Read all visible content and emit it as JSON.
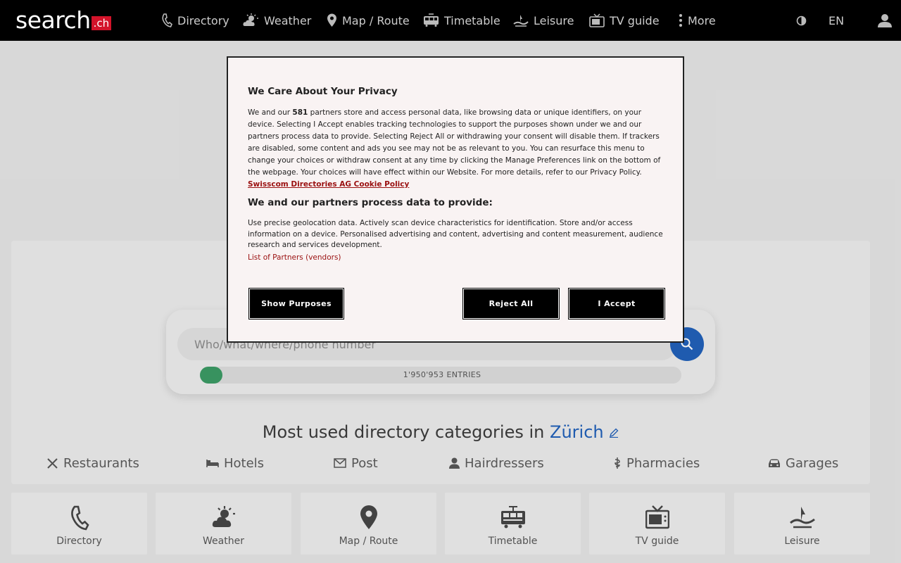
{
  "logo": {
    "text": "search",
    "badge": ".ch"
  },
  "nav": {
    "items": [
      {
        "label": "Directory",
        "icon": "phone-icon"
      },
      {
        "label": "Weather",
        "icon": "weather-icon"
      },
      {
        "label": "Map / Route",
        "icon": "map-pin-icon"
      },
      {
        "label": "Timetable",
        "icon": "train-icon"
      },
      {
        "label": "Leisure",
        "icon": "leisure-icon"
      },
      {
        "label": "TV guide",
        "icon": "tv-icon"
      },
      {
        "label": "More",
        "icon": "more-icon"
      }
    ],
    "language": "EN"
  },
  "search": {
    "placeholder": "Who/what/where/phone number",
    "entries_count": "1'950'953",
    "entries_label": "ENTRIES"
  },
  "categories": {
    "title_prefix": "Most used directory categories in",
    "city": "Zürich",
    "items": [
      {
        "label": "Restaurants",
        "icon": "restaurant-icon"
      },
      {
        "label": "Hotels",
        "icon": "bed-icon"
      },
      {
        "label": "Post",
        "icon": "mail-icon"
      },
      {
        "label": "Hairdressers",
        "icon": "person-icon"
      },
      {
        "label": "Pharmacies",
        "icon": "pharmacy-icon"
      },
      {
        "label": "Garages",
        "icon": "car-icon"
      }
    ]
  },
  "tiles": [
    {
      "label": "Directory"
    },
    {
      "label": "Weather"
    },
    {
      "label": "Map / Route"
    },
    {
      "label": "Timetable"
    },
    {
      "label": "TV guide"
    },
    {
      "label": "Leisure"
    }
  ],
  "consent": {
    "title": "We Care About Your Privacy",
    "body_1": "We and our",
    "partner_count": "581",
    "body_2": "partners store and access personal data, like browsing data or unique identifiers, on your device. Selecting I Accept enables tracking technologies to support the purposes shown under we and our partners process data to provide. Selecting Reject All or withdrawing your consent will disable them. If trackers are disabled, some content and ads you see may not be as relevant to you. You can resurface this menu to change your choices or withdraw consent at any time by clicking the Manage Preferences link on the bottom of the webpage. Your choices will have effect within our Website. For more details, refer to our Privacy Policy.",
    "policy_link": "Swisscom Directories AG Cookie Policy",
    "subtitle": "We and our partners process data to provide:",
    "purposes": "Use precise geolocation data. Actively scan device characteristics for identification. Store and/or access information on a device. Personalised advertising and content, advertising and content measurement, audience research and services development.",
    "partners_link": "List of Partners (vendors)",
    "show_purposes": "Show Purposes",
    "reject_all": "Reject All",
    "accept": "I Accept"
  }
}
